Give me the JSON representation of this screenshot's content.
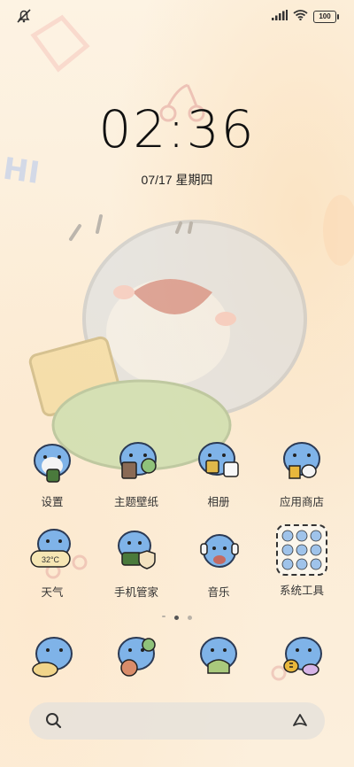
{
  "status": {
    "battery": "100"
  },
  "lock": {
    "time": "02:36",
    "date": "07/17 星期四"
  },
  "apps": [
    {
      "label": "设置",
      "icon": "settings-shark-icon"
    },
    {
      "label": "主题壁纸",
      "icon": "themes-shark-icon"
    },
    {
      "label": "相册",
      "icon": "gallery-shark-icon"
    },
    {
      "label": "应用商店",
      "icon": "app-store-shark-icon"
    },
    {
      "label": "天气",
      "icon": "weather-shark-icon",
      "badge": "32°C"
    },
    {
      "label": "手机管家",
      "icon": "security-shark-icon"
    },
    {
      "label": "音乐",
      "icon": "music-shark-icon"
    },
    {
      "label": "系统工具",
      "icon": "system-tools-folder-icon"
    }
  ],
  "dock": [
    {
      "icon": "phone-shark-icon"
    },
    {
      "icon": "messages-shark-icon"
    },
    {
      "icon": "browser-shark-icon"
    },
    {
      "icon": "camera-shark-icon"
    }
  ],
  "colors": {
    "shark": "#7fb3e8",
    "accent": "#f2c14e",
    "bg": "#fdf3e3"
  }
}
